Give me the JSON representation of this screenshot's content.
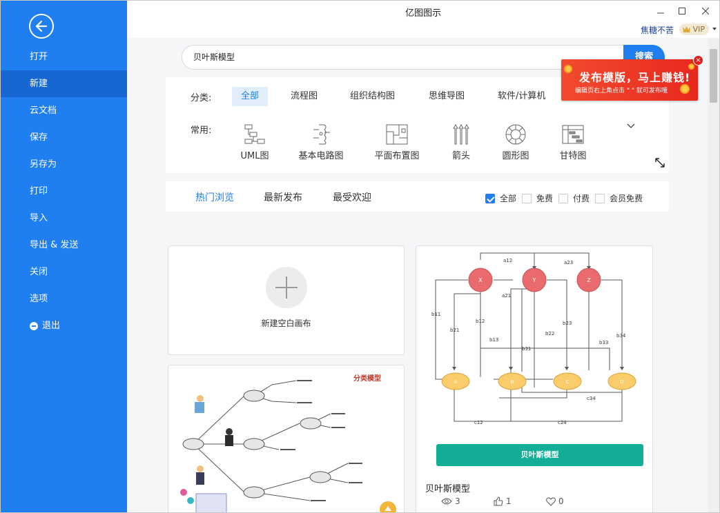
{
  "window": {
    "title": "亿图图示"
  },
  "user": {
    "name": "焦糖不苦",
    "vip_label": "VIP"
  },
  "colors": {
    "brand_blue": "#1f7ef0",
    "sidebar_active": "#1767d2",
    "teal_button": "#14ad96",
    "node_red": "#e96b6e",
    "node_yellow": "#fbcd6a"
  },
  "sidebar": {
    "items": [
      {
        "label": "打开"
      },
      {
        "label": "新建",
        "active": true
      },
      {
        "label": "云文档"
      },
      {
        "label": "保存"
      },
      {
        "label": "另存为"
      },
      {
        "label": "打印"
      },
      {
        "label": "导入"
      },
      {
        "label": "导出 & 发送"
      },
      {
        "label": "关闭"
      },
      {
        "label": "选项"
      },
      {
        "label": "退出",
        "icon": "exit-icon"
      }
    ]
  },
  "search": {
    "value": "贝叶斯模型",
    "button_label": "搜索"
  },
  "promo": {
    "title": "发布模版，马上赚钱!",
    "subtitle": "编辑页右上角点击 \" \" 就可发布哦",
    "close_label": "×"
  },
  "categories": {
    "label": "分类:",
    "tabs": [
      {
        "label": "全部",
        "active": true
      },
      {
        "label": "流程图"
      },
      {
        "label": "组织结构图"
      },
      {
        "label": "思维导图"
      },
      {
        "label": "软件/计算机"
      }
    ]
  },
  "common": {
    "label": "常用:",
    "items": [
      {
        "label": "UML图",
        "icon": "uml-icon"
      },
      {
        "label": "基本电路图",
        "icon": "circuit-icon"
      },
      {
        "label": "平面布置图",
        "icon": "floorplan-icon"
      },
      {
        "label": "箭头",
        "icon": "arrow-icon"
      },
      {
        "label": "圆形图",
        "icon": "circle-chart-icon"
      },
      {
        "label": "甘特图",
        "icon": "gantt-icon"
      }
    ]
  },
  "sort_tabs": [
    {
      "label": "热门浏览",
      "active": true
    },
    {
      "label": "最新发布"
    },
    {
      "label": "最受欢迎"
    }
  ],
  "filters": [
    {
      "label": "全部",
      "checked": true
    },
    {
      "label": "免费",
      "checked": false
    },
    {
      "label": "付费",
      "checked": false
    },
    {
      "label": "会员免费",
      "checked": false
    }
  ],
  "new_blank": {
    "label": "新建空白画布"
  },
  "classification_card": {
    "heading": "分类模型"
  },
  "bayes_card": {
    "title": "贝叶斯模型",
    "button_label": "贝叶斯模型",
    "views": "3",
    "likes": "1",
    "favorites": "0",
    "diagram": {
      "top_nodes": [
        "X",
        "Y",
        "Z"
      ],
      "bottom_nodes": [
        "A",
        "B",
        "C",
        "D"
      ],
      "edge_labels": [
        "a12",
        "a23",
        "a21",
        "b11",
        "b12",
        "b21",
        "b13",
        "b22",
        "b23",
        "b31",
        "b33",
        "b34",
        "c34",
        "c12",
        "c24"
      ]
    }
  }
}
